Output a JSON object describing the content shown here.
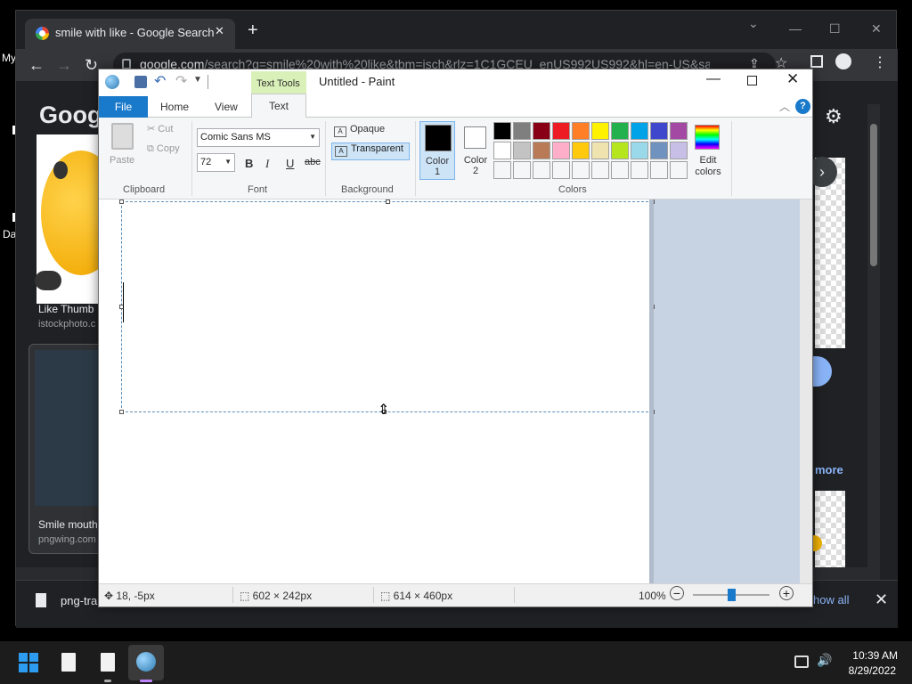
{
  "desktop": {
    "label_top": "My",
    "label_bottom": "Da"
  },
  "browser": {
    "tab_title": "smile with like - Google Search",
    "tab_close": "✕",
    "new_tab": "+",
    "url_host": "google.com",
    "url_path": "/search?q=smile%20with%20like&tbm=isch&rlz=1C1GCEU_enUS992US992&hl=en-US&sa=X...",
    "window_controls": {
      "minimize": "—",
      "maximize": "☐",
      "close": "✕"
    },
    "nav": {
      "back": "←",
      "forward": "→",
      "reload": "↻"
    }
  },
  "google_page": {
    "logo": "Goog",
    "result1": {
      "caption": "Like Thumb",
      "source": "istockphoto.c"
    },
    "result2": {
      "caption": "Smile mouth",
      "source": "pngwing.com"
    },
    "more_link": "more",
    "next_arrow": "›"
  },
  "download_bar": {
    "file_name": "png-tra",
    "show_all": "how all",
    "close": "✕"
  },
  "paint": {
    "window_title": "Untitled - Paint",
    "context_tab_group": "Text Tools",
    "tabs": [
      "File",
      "Home",
      "View",
      "Text"
    ],
    "active_tab": "Text",
    "clipboard": {
      "paste": "Paste",
      "cut": "Cut",
      "copy": "Copy",
      "group": "Clipboard"
    },
    "font": {
      "family": "Comic Sans MS",
      "size": "72",
      "bold": "B",
      "italic": "I",
      "underline": "U",
      "strikethrough": "abc",
      "group": "Font"
    },
    "background": {
      "opaque": "Opaque",
      "transparent": "Transparent",
      "selected": "Transparent",
      "group": "Background"
    },
    "colors": {
      "color1_label": "Color",
      "color1_num": "1",
      "color2_label": "Color",
      "color2_num": "2",
      "color1": "#000000",
      "color2": "#ffffff",
      "edit_label_1": "Edit",
      "edit_label_2": "colors",
      "group": "Colors",
      "palette_row1": [
        "#000000",
        "#7f7f7f",
        "#880015",
        "#ed1c24",
        "#ff7f27",
        "#fff200",
        "#22b14c",
        "#00a2e8",
        "#3f48cc",
        "#a349a4"
      ],
      "palette_row2": [
        "#ffffff",
        "#c3c3c3",
        "#b97a57",
        "#ffaec9",
        "#ffc90e",
        "#efe4b0",
        "#b5e61d",
        "#99d9ea",
        "#7092be",
        "#c8bfe7"
      ],
      "palette_row3": [
        "#f5f6f7",
        "#f5f6f7",
        "#f5f6f7",
        "#f5f6f7",
        "#f5f6f7",
        "#f5f6f7",
        "#f5f6f7",
        "#f5f6f7",
        "#f5f6f7",
        "#f5f6f7"
      ]
    },
    "status": {
      "cursor_pos": "18, -5px",
      "selection_size": "602 × 242px",
      "image_size": "614 × 460px",
      "zoom": "100%"
    }
  },
  "taskbar": {
    "time": "10:39 AM",
    "date": "8/29/2022"
  }
}
